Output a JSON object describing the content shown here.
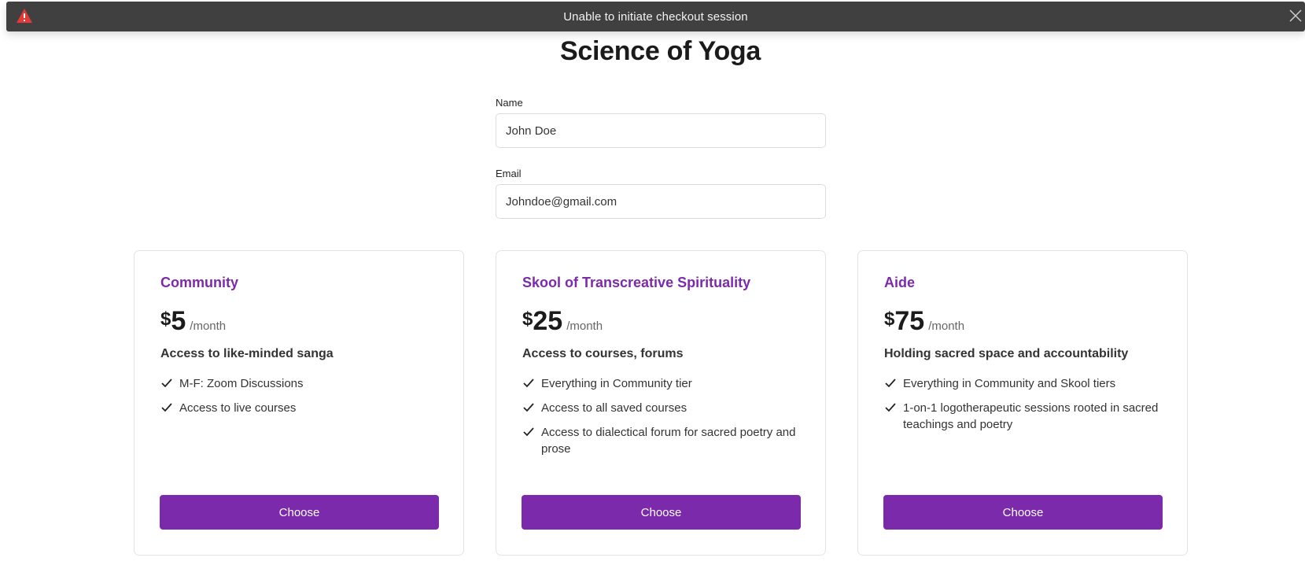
{
  "toast": {
    "message": "Unable to initiate checkout session",
    "warning_icon": "warning-triangle-icon",
    "close_icon": "close-icon",
    "warning_color": "#e53935"
  },
  "page": {
    "title": "Science of Yoga"
  },
  "form": {
    "name_label": "Name",
    "name_value": "John Doe",
    "email_label": "Email",
    "email_value": "Johndoe@gmail.com"
  },
  "theme": {
    "accent": "#7a2aab"
  },
  "plans": [
    {
      "name": "Community",
      "currency": "$",
      "amount": "5",
      "period": "/month",
      "tagline": "Access to like-minded sanga",
      "features": [
        "M-F: Zoom Discussions",
        "Access to live courses"
      ],
      "button_label": "Choose"
    },
    {
      "name": "Skool of Transcreative Spirituality",
      "currency": "$",
      "amount": "25",
      "period": "/month",
      "tagline": "Access to courses, forums",
      "features": [
        "Everything in Community tier",
        "Access to all saved courses",
        "Access to dialectical forum for sacred poetry and prose"
      ],
      "button_label": "Choose"
    },
    {
      "name": "Aide",
      "currency": "$",
      "amount": "75",
      "period": "/month",
      "tagline": "Holding sacred space and accountability",
      "features": [
        "Everything in Community and Skool tiers",
        "1-on-1 logotherapeutic sessions rooted in sacred teachings and poetry"
      ],
      "button_label": "Choose"
    }
  ]
}
